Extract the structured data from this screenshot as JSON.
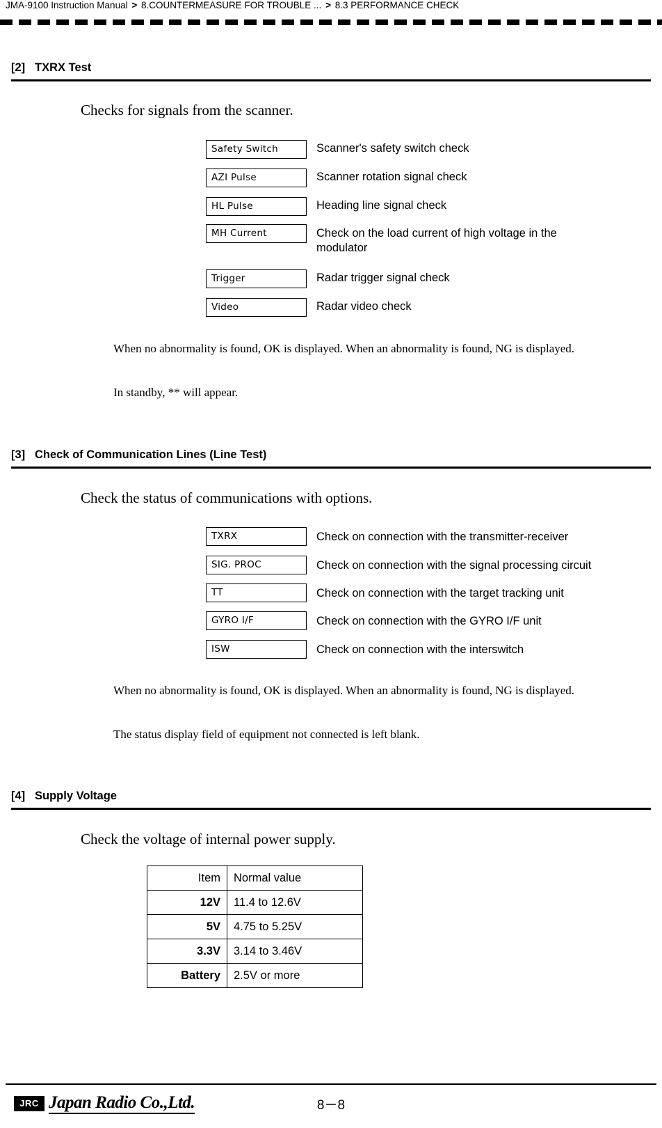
{
  "breadcrumb": {
    "part1": "JMA-9100 Instruction Manual",
    "sep": ">",
    "part2": "8.COUNTERMEASURE FOR TROUBLE ...",
    "part3": "8.3  PERFORMANCE CHECK"
  },
  "sections": [
    {
      "num": "[2]",
      "title": "TXRX Test",
      "intro": "Checks for signals from the scanner.",
      "items": [
        {
          "label": "Safety Switch",
          "desc": "Scanner's safety switch check"
        },
        {
          "label": "AZI Pulse",
          "desc": "Scanner rotation signal check"
        },
        {
          "label": "HL Pulse",
          "desc": "Heading line signal check"
        },
        {
          "label": "MH Current",
          "desc": "Check on the load current of high voltage in the modulator"
        },
        {
          "label": "Trigger",
          "desc": "Radar trigger signal check"
        },
        {
          "label": "Video",
          "desc": "Radar video check"
        }
      ],
      "notes": [
        "When no abnormality is found, OK is displayed. When an abnormality is found, NG is displayed.",
        "In standby, ** will appear."
      ]
    },
    {
      "num": "[3]",
      "title": "Check of Communication Lines (Line Test)",
      "intro": "Check the status of communications with options.",
      "items": [
        {
          "label": "TXRX",
          "desc": "Check on connection with the transmitter-receiver"
        },
        {
          "label": "SIG. PROC",
          "desc": "Check on connection with the signal processing circuit"
        },
        {
          "label": "TT",
          "desc": "Check on connection with the target tracking unit"
        },
        {
          "label": "GYRO I/F",
          "desc": "Check on connection with the GYRO I/F unit"
        },
        {
          "label": "ISW",
          "desc": "Check on connection with the interswitch"
        }
      ],
      "notes": [
        "When no abnormality is found, OK is displayed. When an abnormality is found, NG is displayed.",
        "The status display field of equipment not connected is left blank."
      ]
    },
    {
      "num": "[4]",
      "title": "Supply Voltage",
      "intro": "Check the voltage of internal power supply."
    }
  ],
  "voltage_table": {
    "headers": [
      "Item",
      "Normal value"
    ],
    "rows": [
      [
        "12V",
        "11.4 to 12.6V"
      ],
      [
        "5V",
        "4.75 to 5.25V"
      ],
      [
        "3.3V",
        "3.14 to 3.46V"
      ],
      [
        "Battery",
        "2.5V or more"
      ]
    ]
  },
  "footer": {
    "logo": "JRC",
    "company": "Japan Radio Co.,Ltd.",
    "page": "8－8"
  }
}
